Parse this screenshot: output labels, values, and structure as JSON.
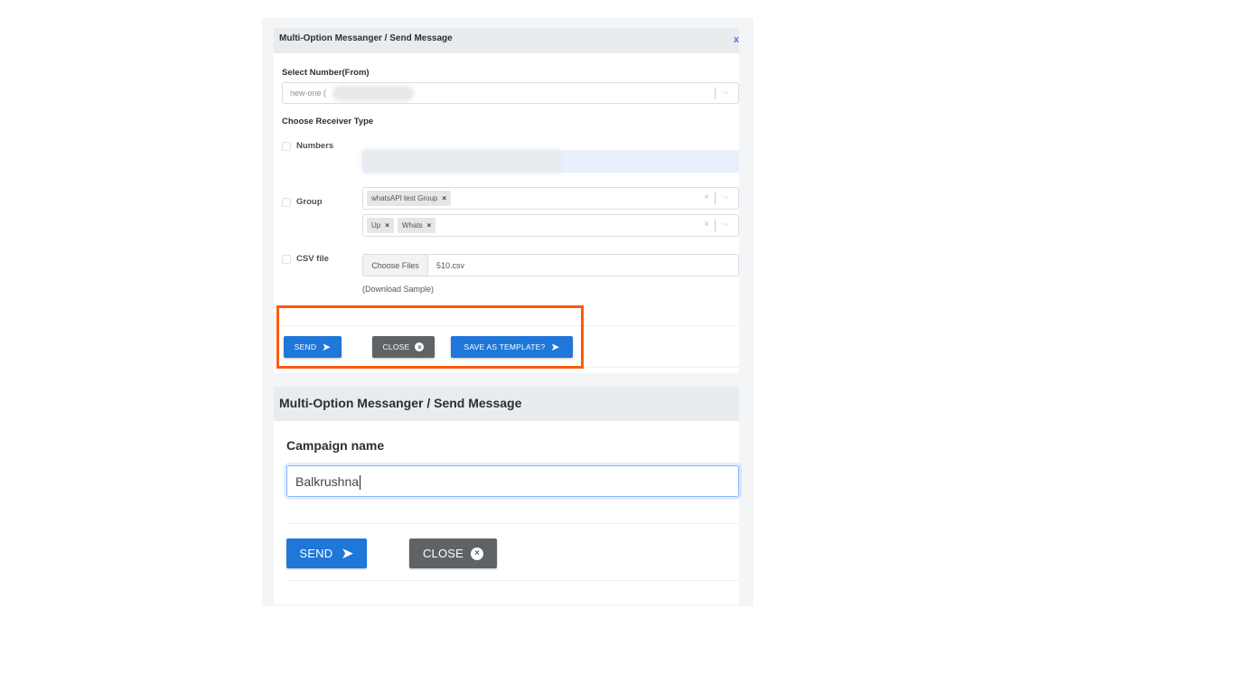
{
  "panel_top": {
    "breadcrumb": "Multi-Option Messanger /  Send Message",
    "close_label": "x",
    "select_number_label": "Select Number(From)",
    "select_number_value": "new-one (",
    "receiver_type_label": "Choose Receiver Type",
    "receivers": {
      "numbers_label": "Numbers",
      "group_label": "Group",
      "csv_label": "CSV file"
    },
    "group_select_1": {
      "tags": [
        "whatsAPI test Group"
      ]
    },
    "group_select_2": {
      "tags": [
        "Up",
        "Whats"
      ]
    },
    "tag_remove_glyph": "×",
    "clear_glyph": "×",
    "chevron_glyph": "⌵",
    "file": {
      "choose_label": "Choose Files",
      "file_name": "510.csv"
    },
    "download_sample": "(Download Sample)",
    "buttons": {
      "send": "SEND",
      "close": "CLOSE",
      "save_template": "SAVE AS TEMPLATE?"
    },
    "icons": {
      "send": "➤",
      "close": "×"
    }
  },
  "panel_bottom": {
    "breadcrumb": "Multi-Option Messanger /  Send Message",
    "campaign_label": "Campaign name",
    "campaign_value": "Balkrushna",
    "buttons": {
      "send": "SEND",
      "close": "CLOSE"
    }
  },
  "colors": {
    "primary": "#1f77d9",
    "secondary": "#5f6366",
    "highlight": "#ff5a0a",
    "header_bg": "#e9ecef"
  }
}
